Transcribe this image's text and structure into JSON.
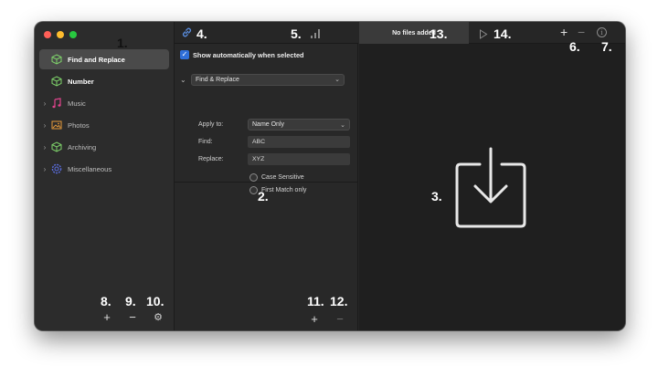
{
  "sidebar": {
    "items": [
      {
        "label": "Find and Replace",
        "icon": "cube-icon",
        "color": "#7fd46b",
        "selected": true
      },
      {
        "label": "Number",
        "icon": "cube-icon",
        "color": "#7fd46b",
        "selected": false
      },
      {
        "label": "Music",
        "icon": "music-note-icon",
        "color": "#e0448c",
        "selected": false
      },
      {
        "label": "Photos",
        "icon": "photo-icon",
        "color": "#e89b3a",
        "selected": false
      },
      {
        "label": "Archiving",
        "icon": "cube-icon",
        "color": "#7fd46b",
        "selected": false
      },
      {
        "label": "Miscellaneous",
        "icon": "gear-icon",
        "color": "#5b6ee0",
        "selected": false
      }
    ],
    "bottom": {
      "add": "+",
      "remove": "−",
      "settings": "⚙"
    }
  },
  "mid": {
    "show_auto_label": "Show automatically when selected",
    "action": "Find & Replace",
    "apply_label": "Apply to:",
    "apply_value": "Name Only",
    "find_label": "Find:",
    "find_value": "ABC",
    "replace_label": "Replace:",
    "replace_value": "XYZ",
    "case_label": "Case Sensitive",
    "first_match_label": "First Match only",
    "bottom": {
      "add": "+",
      "remove": "−"
    }
  },
  "right": {
    "status": "No files added",
    "plus": "+",
    "minus": "−",
    "info": "i"
  },
  "callouts": [
    "1.",
    "2.",
    "3.",
    "4.",
    "5.",
    "6.",
    "7.",
    "8.",
    "9.",
    "10.",
    "11.",
    "12.",
    "13.",
    "14."
  ],
  "colors": {
    "traffic_red": "#ff5f57",
    "traffic_yellow": "#febc2e",
    "traffic_green": "#28c840",
    "accent_blue": "#2f6fd8"
  }
}
